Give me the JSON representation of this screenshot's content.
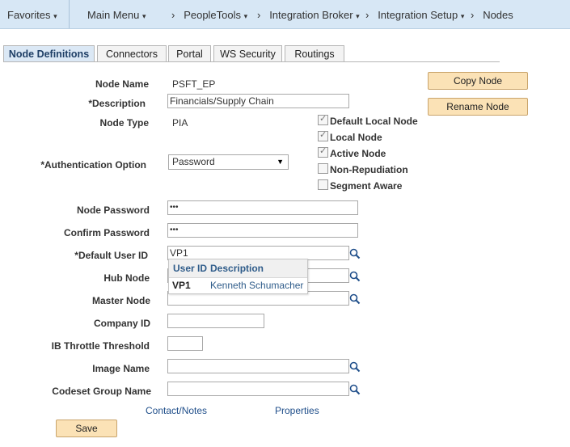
{
  "breadcrumb": {
    "favorites": "Favorites",
    "main_menu": "Main Menu",
    "peopletools": "PeopleTools",
    "integration_broker": "Integration Broker",
    "integration_setup": "Integration Setup",
    "nodes": "Nodes",
    "dropdown_glyph": "▾",
    "separator_glyph": "›"
  },
  "tabs": [
    "Node Definitions",
    "Connectors",
    "Portal",
    "WS Security",
    "Routings"
  ],
  "active_tab": "Node Definitions",
  "form": {
    "node_name_label": "Node Name",
    "node_name_value": "PSFT_EP",
    "description_label": "*Description",
    "description_value": "Financials/Supply Chain",
    "node_type_label": "Node Type",
    "node_type_value": "PIA",
    "auth_option_label": "*Authentication Option",
    "auth_option_value": "Password",
    "node_password_label": "Node Password",
    "node_password_value": "•••",
    "confirm_password_label": "Confirm Password",
    "confirm_password_value": "•••",
    "default_user_id_label": "*Default User ID",
    "default_user_id_value": "VP1",
    "hub_node_label": "Hub Node",
    "hub_node_value": "",
    "master_node_label": "Master Node",
    "master_node_value": "",
    "company_id_label": "Company ID",
    "company_id_value": "",
    "ib_throttle_label": "IB Throttle Threshold",
    "ib_throttle_value": "",
    "image_name_label": "Image Name",
    "image_name_value": "",
    "codeset_group_label": "Codeset Group Name",
    "codeset_group_value": ""
  },
  "checkboxes": {
    "default_local_node": {
      "label": "Default Local Node",
      "checked": true
    },
    "local_node": {
      "label": "Local Node",
      "checked": true
    },
    "active_node": {
      "label": "Active Node",
      "checked": true
    },
    "non_repudiation": {
      "label": "Non-Repudiation",
      "checked": false
    },
    "segment_aware": {
      "label": "Segment Aware",
      "checked": false
    }
  },
  "buttons": {
    "copy_node": "Copy Node",
    "rename_node": "Rename Node",
    "save": "Save"
  },
  "links": {
    "contact_notes": "Contact/Notes",
    "properties": "Properties"
  },
  "lookup_popup": {
    "col_user_id": "User ID",
    "col_description": "Description",
    "row_user_id": "VP1",
    "row_description": "Kenneth Schumacher"
  },
  "icons": {
    "lookup": "magnifier-icon",
    "dropdown": "chevron-down-icon",
    "checkmark": "check-icon"
  },
  "colors": {
    "topbar_bg": "#d7e7f5",
    "active_tab_bg": "#dbe8f5",
    "button_bg": "#fbe2b6",
    "link": "#1f4e8a"
  }
}
